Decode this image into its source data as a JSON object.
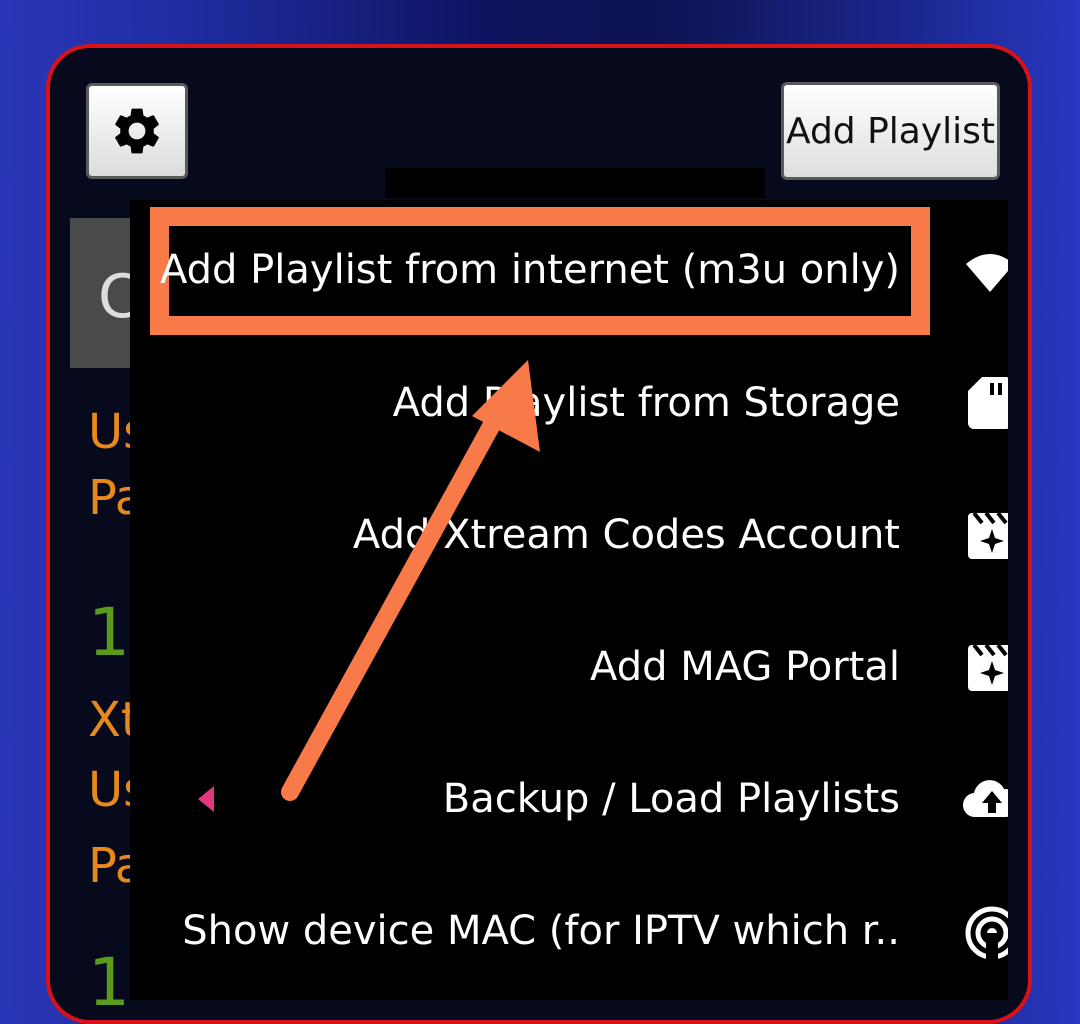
{
  "toolbar": {
    "settings_icon": "gear-icon",
    "add_playlist_label": "Add Playlist"
  },
  "background_list": {
    "tile_letter": "C",
    "lines": [
      "Us",
      "Pa",
      "1",
      "Xt",
      "Us",
      "Pa",
      "1"
    ]
  },
  "menu": {
    "items": [
      {
        "label": "Add Playlist from internet (m3u only)",
        "icon": "wifi-icon",
        "highlighted": true
      },
      {
        "label": "Add Playlist from Storage",
        "icon": "sd-card-icon"
      },
      {
        "label": "Add Xtream Codes Account",
        "icon": "movie-clapper-icon"
      },
      {
        "label": "Add MAG Portal",
        "icon": "movie-clapper-icon"
      },
      {
        "label": "Backup / Load Playlists",
        "icon": "cloud-upload-icon",
        "has_submenu_caret": true
      },
      {
        "label": "Show device MAC (for IPTV which r..",
        "icon": "broadcast-icon"
      }
    ]
  },
  "colors": {
    "highlight": "#f87a48",
    "panel_border": "#d81218",
    "accent_orange_text": "#e8891c",
    "accent_green_text": "#5a9b1c"
  }
}
